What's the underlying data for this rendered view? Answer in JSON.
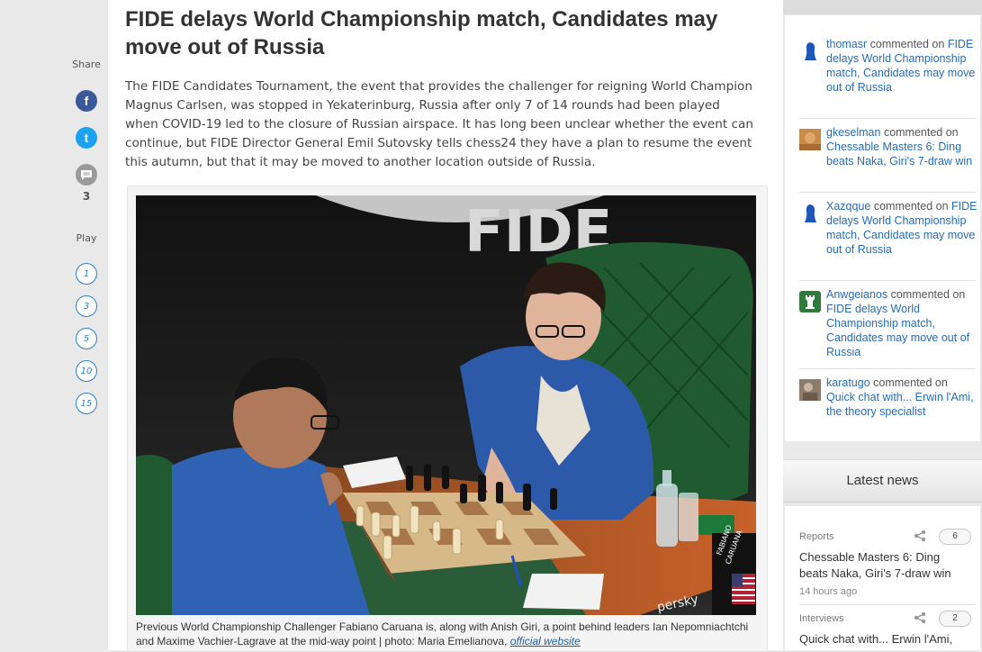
{
  "share": {
    "label": "Share",
    "facebook_glyph": "f",
    "twitter_glyph": "t",
    "comments_count": "3"
  },
  "play": {
    "label": "Play",
    "options": [
      "1",
      "3",
      "5",
      "10",
      "15"
    ]
  },
  "article": {
    "title": "FIDE delays World Championship match, Candidates may move out of Russia",
    "intro": "The FIDE Candidates Tournament, the event that provides the challenger for reigning World Champion Magnus Carlsen, was stopped in Yekaterinburg, Russia after only 7 of 14 rounds had been played when COVID-19 led to the closure of Russian airspace. It has long been unclear whether the event can continue, but FIDE Director General Emil Sutovsky tells chess24 they have a plan to resume the event this autumn, but that it may be moved to another location outside of Russia.",
    "photo": {
      "backdrop_text": "FIDE",
      "table_sign_1": "FABIANO",
      "table_sign_2": "CARUANA",
      "sponsor_text": "persky"
    },
    "caption": "Previous World Championship Challenger Fabiano Caruana is, along with Anish Giri, a point behind leaders Ian Nepomniachtchi and Maxime Vachier-Lagrave at the mid-way point | photo: Maria Emelianova,",
    "caption_link": "official website"
  },
  "comments": [
    {
      "user": "thomasr",
      "action": "commented on",
      "target": "FIDE delays World Championship match, Candidates may move out of Russia",
      "avatar": "blue-pawn"
    },
    {
      "user": "gkeselman",
      "action": "commented on",
      "target": "Chessable Masters 6: Ding beats Naka, Giri's 7-draw win",
      "avatar": "photo"
    },
    {
      "user": "Xazqque",
      "action": "commented on",
      "target": "FIDE delays World Championship match, Candidates may move out of Russia",
      "avatar": "blue-pawn"
    },
    {
      "user": "Anwgeianos",
      "action": "commented on",
      "target": "FIDE delays World Championship match, Candidates may move out of Russia",
      "avatar": "green-rook"
    },
    {
      "user": "karatugo",
      "action": "commented on",
      "target": "Quick chat with... Erwin l'Ami, the theory specialist",
      "avatar": "photo"
    }
  ],
  "latest_news": {
    "heading": "Latest news",
    "items": [
      {
        "category": "Reports",
        "title": "Chessable Masters 6: Ding beats Naka, Giri's 7-draw win",
        "time": "14 hours ago",
        "comments": "6"
      },
      {
        "category": "Interviews",
        "title": "Quick chat with... Erwin l'Ami,",
        "comments": "2"
      }
    ]
  },
  "colors": {
    "facebook": "#3b5998",
    "twitter": "#1da1f2",
    "link": "#2a6bb0",
    "play_ring": "#2b7fc4"
  }
}
